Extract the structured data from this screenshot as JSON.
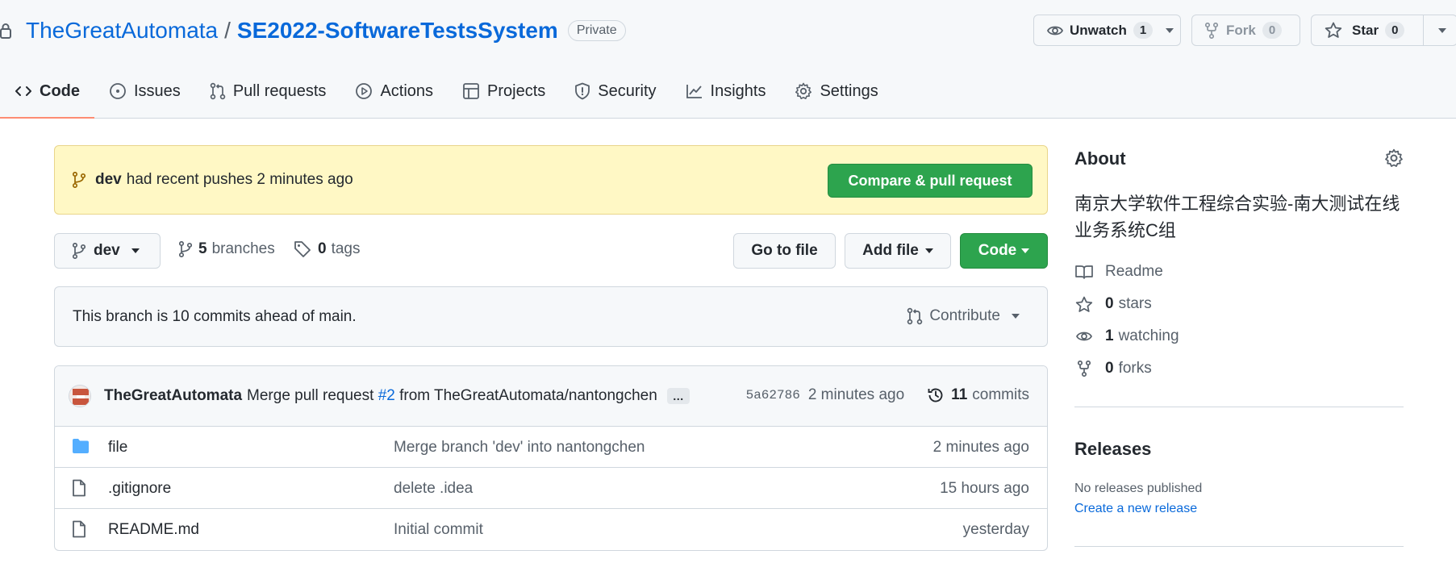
{
  "header": {
    "owner": "TheGreatAutomata",
    "separator": "/",
    "repo": "SE2022-SoftwareTestsSystem",
    "visibility": "Private",
    "unwatch": {
      "label": "Unwatch",
      "count": "1"
    },
    "fork": {
      "label": "Fork",
      "count": "0"
    },
    "star": {
      "label": "Star",
      "count": "0"
    }
  },
  "tabs": [
    {
      "label": "Code",
      "icon": "code-icon"
    },
    {
      "label": "Issues",
      "icon": "issue-icon"
    },
    {
      "label": "Pull requests",
      "icon": "pull-request-icon"
    },
    {
      "label": "Actions",
      "icon": "play-icon"
    },
    {
      "label": "Projects",
      "icon": "table-icon"
    },
    {
      "label": "Security",
      "icon": "shield-icon"
    },
    {
      "label": "Insights",
      "icon": "graph-icon"
    },
    {
      "label": "Settings",
      "icon": "gear-icon"
    }
  ],
  "banner": {
    "branch": "dev",
    "text": "had recent pushes 2 minutes ago",
    "compare_label": "Compare & pull request"
  },
  "toolbar": {
    "branch": "dev",
    "branches_count": "5",
    "branches_label": "branches",
    "tags_count": "0",
    "tags_label": "tags",
    "goto_file": "Go to file",
    "add_file": "Add file",
    "code": "Code"
  },
  "ahead": {
    "text": "This branch is 10 commits ahead of main.",
    "contribute": "Contribute"
  },
  "commit": {
    "author": "TheGreatAutomata",
    "message_prefix": "Merge pull request",
    "pr_link": "#2",
    "message_suffix": "from TheGreatAutomata/nantongchen",
    "ellipsis": "…",
    "sha": "5a62786",
    "age": "2 minutes ago",
    "count": "11",
    "count_label": "commits"
  },
  "files": [
    {
      "name": "file",
      "type": "folder",
      "message": "Merge branch 'dev' into nantongchen",
      "age": "2 minutes ago"
    },
    {
      "name": ".gitignore",
      "type": "file",
      "message": "delete .idea",
      "age": "15 hours ago"
    },
    {
      "name": "README.md",
      "type": "file",
      "message": "Initial commit",
      "age": "yesterday"
    }
  ],
  "about": {
    "title": "About",
    "description": "南京大学软件工程综合实验-南大测试在线业务系统C组",
    "readme": "Readme",
    "stars_count": "0",
    "stars_label": "stars",
    "watching_count": "1",
    "watching_label": "watching",
    "forks_count": "0",
    "forks_label": "forks"
  },
  "releases": {
    "title": "Releases",
    "none": "No releases published",
    "create": "Create a new release"
  },
  "colors": {
    "link": "#0969da",
    "primary_green": "#2da44e",
    "banner_bg": "#fff8c5",
    "tab_underline": "#fd8c73"
  }
}
